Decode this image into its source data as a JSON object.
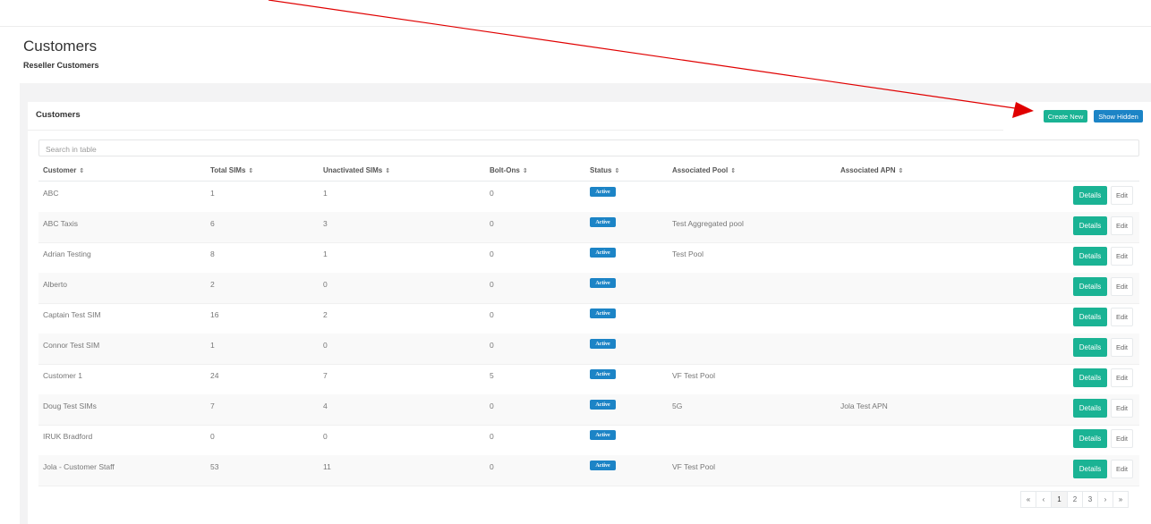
{
  "page": {
    "title": "Customers",
    "subtitle": "Reseller Customers"
  },
  "panel": {
    "title": "Customers",
    "create_label": "Create New",
    "hidden_label": "Show Hidden"
  },
  "search": {
    "placeholder": "Search in table"
  },
  "table": {
    "columns": [
      "Customer",
      "Total SIMs",
      "Unactivated SIMs",
      "Bolt-Ons",
      "Status",
      "Associated Pool",
      "Associated APN"
    ],
    "sort_icon": "⇕",
    "rows": [
      {
        "customer": "ABC",
        "total_sims": "1",
        "unactivated_sims": "1",
        "bolt_ons": "0",
        "status": "Active",
        "pool": "",
        "apn": "",
        "details": "Details",
        "edit": "Edit"
      },
      {
        "customer": "ABC Taxis",
        "total_sims": "6",
        "unactivated_sims": "3",
        "bolt_ons": "0",
        "status": "Active",
        "pool": "Test Aggregated pool",
        "apn": "",
        "details": "Details",
        "edit": "Edit"
      },
      {
        "customer": "Adrian Testing",
        "total_sims": "8",
        "unactivated_sims": "1",
        "bolt_ons": "0",
        "status": "Active",
        "pool": "Test Pool",
        "apn": "",
        "details": "Details",
        "edit": "Edit"
      },
      {
        "customer": "Alberto",
        "total_sims": "2",
        "unactivated_sims": "0",
        "bolt_ons": "0",
        "status": "Active",
        "pool": "",
        "apn": "",
        "details": "Details",
        "edit": "Edit"
      },
      {
        "customer": "Captain Test SIM",
        "total_sims": "16",
        "unactivated_sims": "2",
        "bolt_ons": "0",
        "status": "Active",
        "pool": "",
        "apn": "",
        "details": "Details",
        "edit": "Edit"
      },
      {
        "customer": "Connor Test SIM",
        "total_sims": "1",
        "unactivated_sims": "0",
        "bolt_ons": "0",
        "status": "Active",
        "pool": "",
        "apn": "",
        "details": "Details",
        "edit": "Edit"
      },
      {
        "customer": "Customer 1",
        "total_sims": "24",
        "unactivated_sims": "7",
        "bolt_ons": "5",
        "status": "Active",
        "pool": "VF Test Pool",
        "apn": "",
        "details": "Details",
        "edit": "Edit"
      },
      {
        "customer": "Doug Test SIMs",
        "total_sims": "7",
        "unactivated_sims": "4",
        "bolt_ons": "0",
        "status": "Active",
        "pool": "5G",
        "apn": "Jola Test APN",
        "details": "Details",
        "edit": "Edit"
      },
      {
        "customer": "IRUK Bradford",
        "total_sims": "0",
        "unactivated_sims": "0",
        "bolt_ons": "0",
        "status": "Active",
        "pool": "",
        "apn": "",
        "details": "Details",
        "edit": "Edit"
      },
      {
        "customer": "Jola - Customer Staff",
        "total_sims": "53",
        "unactivated_sims": "11",
        "bolt_ons": "0",
        "status": "Active",
        "pool": "VF Test Pool",
        "apn": "",
        "details": "Details",
        "edit": "Edit"
      }
    ]
  },
  "pagination": {
    "items": [
      "«",
      "‹",
      "1",
      "2",
      "3",
      "›",
      "»"
    ],
    "active": "1"
  },
  "annotation": {
    "arrow_color": "#e00000"
  },
  "colors": {
    "primary_green": "#1ab394",
    "primary_blue": "#1c84c6"
  }
}
